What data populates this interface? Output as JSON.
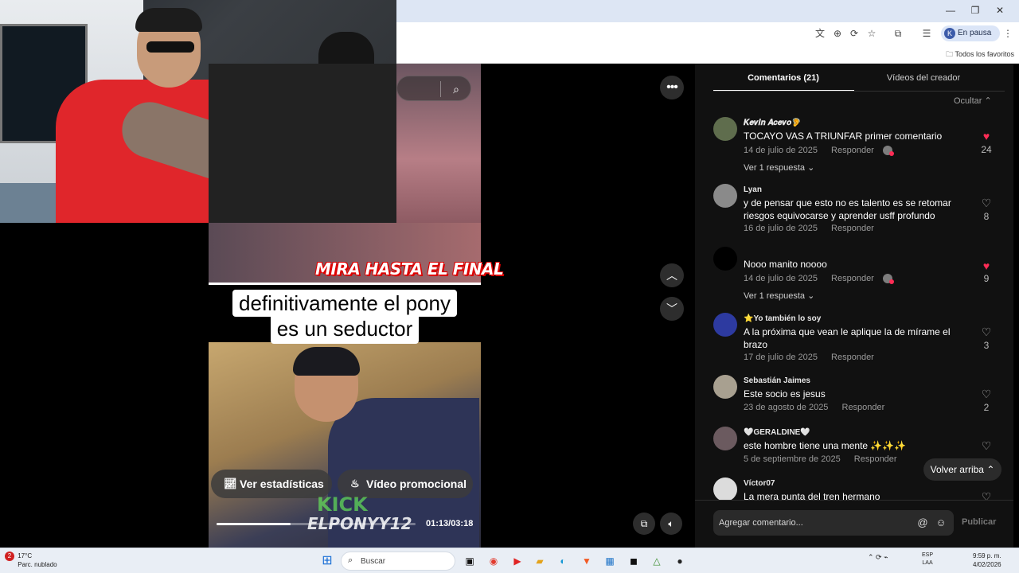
{
  "browser": {
    "profile_initial": "K",
    "profile_status": "En pausa",
    "bookmarks_folder": "Todos los favoritos",
    "window_controls": [
      "—",
      "❐",
      "✕"
    ]
  },
  "video": {
    "banner": "MIRA HASTA EL FINAL",
    "caption_line1": "definitivamente el pony",
    "caption_line2": "es un seductor",
    "stats_label": "Ver estadísticas",
    "promo_label": "Vídeo promocional",
    "logo_text": "KICK",
    "watermark": "ELPONYY12",
    "timecode": "01:13/03:18",
    "progress": 0.37
  },
  "tabs": {
    "comments": "Comentarios (21)",
    "creator_videos": "Vídeos del creador",
    "hide": "Ocultar"
  },
  "comments": [
    {
      "user": "𝑲𝒆𝒗𝒊𝒏 𝑨𝒄𝒆𝒗𝒐🦻",
      "text": "TOCAYO VAS A TRIUNFAR primer comentario",
      "date": "14 de julio de 2025",
      "reply": "Responder",
      "likes": "24",
      "liked": true,
      "thread": "Ver 1 respuesta",
      "creator_liked": true
    },
    {
      "user": "Lyan",
      "text": "y de pensar que esto no es talento es se retomar riesgos equivocarse y aprender usff profundo",
      "date": "16 de julio de 2025",
      "reply": "Responder",
      "likes": "8",
      "liked": false
    },
    {
      "user": "",
      "text": "Nooo manito noooo",
      "date": "14 de julio de 2025",
      "reply": "Responder",
      "likes": "9",
      "liked": true,
      "thread": "Ver 1 respuesta",
      "creator_liked": true
    },
    {
      "user": "⭐Yo también lo soy",
      "text": "A la próxima que vean le aplique la de mírame el brazo",
      "date": "17 de julio de 2025",
      "reply": "Responder",
      "likes": "3",
      "liked": false
    },
    {
      "user": "Sebastián Jaimes",
      "text": "Este socio es jesus",
      "date": "23 de agosto de 2025",
      "reply": "Responder",
      "likes": "2",
      "liked": false
    },
    {
      "user": "🤍GERALDINE🤍",
      "text": "este hombre tiene una mente ✨✨✨",
      "date": "5 de septiembre de 2025",
      "reply": "Responder",
      "likes": "",
      "liked": false
    },
    {
      "user": "Víctor07",
      "text": "La mera punta del tren hermano",
      "date": "",
      "reply": "",
      "likes": "",
      "liked": false
    }
  ],
  "composer": {
    "placeholder": "Agregar comentario...",
    "publish": "Publicar",
    "back_to_top": "Volver arriba"
  },
  "taskbar": {
    "weather_badge": "2",
    "temp": "17°C",
    "condition": "Parc. nublado",
    "search": "Buscar",
    "lang_top": "ESP",
    "lang_bottom": "LAA",
    "time": "9:59 p. m.",
    "date": "4/02/2026"
  }
}
